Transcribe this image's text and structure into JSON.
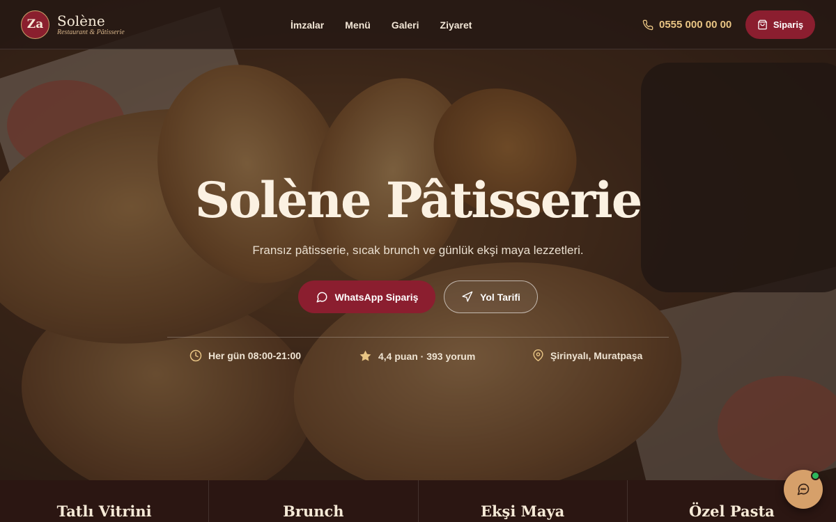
{
  "header": {
    "logo_initials": "Za",
    "brand_name": "Solène",
    "brand_tagline": "Restaurant & Pâtisserie",
    "nav": [
      "İmzalar",
      "Menü",
      "Galeri",
      "Ziyaret"
    ],
    "phone": "0555 000 00 00",
    "order_label": "Sipariş"
  },
  "hero": {
    "title": "Solène Pâtisserie",
    "subtitle": "Fransız pâtisserie, sıcak brunch ve günlük ekşi maya lezzetleri.",
    "whatsapp_label": "WhatsApp Sipariş",
    "directions_label": "Yol Tarifi",
    "hours": "Her gün 08:00-21:00",
    "rating": "4,4 puan · 393 yorum",
    "location": "Şirinyalı, Muratpaşa"
  },
  "categories": [
    "Tatlı Vitrini",
    "Brunch",
    "Ekşi Maya",
    "Özel Pasta"
  ],
  "colors": {
    "accent": "#8b1e2f",
    "gold": "#e9c584",
    "background": "#2b1612"
  }
}
